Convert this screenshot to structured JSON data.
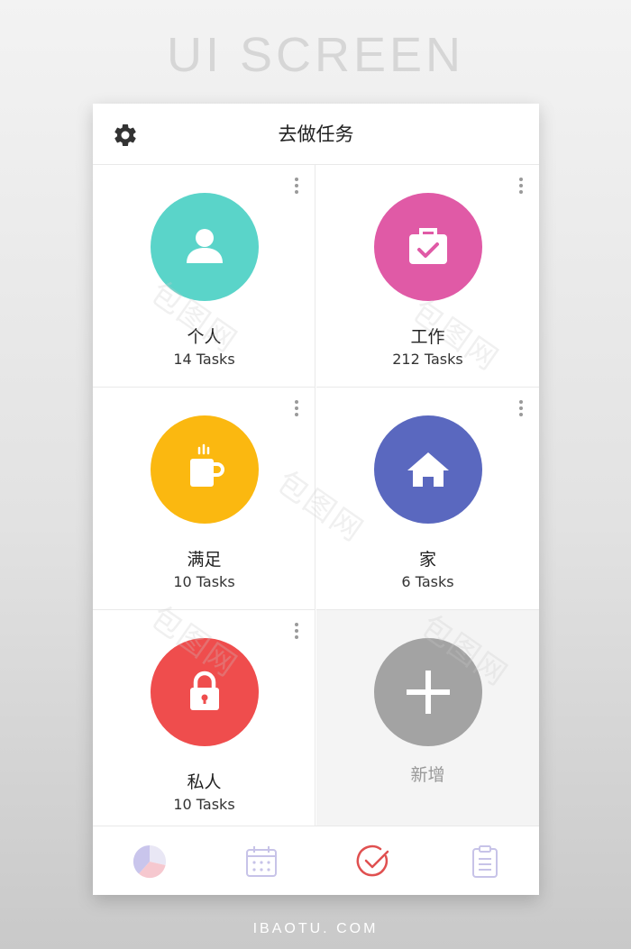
{
  "banner": "UI SCREEN",
  "footer_watermark": "IBAOTU. COM",
  "watermark_text": "包图网",
  "header": {
    "title": "去做任务",
    "settings_icon": "gear-icon"
  },
  "categories": [
    {
      "name": "个人",
      "count": "14 Tasks",
      "color": "#5ad4c9",
      "icon": "person-icon"
    },
    {
      "name": "工作",
      "count": "212 Tasks",
      "color": "#e05aa6",
      "icon": "briefcase-check-icon"
    },
    {
      "name": "满足",
      "count": "10 Tasks",
      "color": "#fbb810",
      "icon": "coffee-mug-icon"
    },
    {
      "name": "家",
      "count": "6 Tasks",
      "color": "#5a68bf",
      "icon": "house-icon"
    },
    {
      "name": "私人",
      "count": "10 Tasks",
      "color": "#ef4d4d",
      "icon": "lock-icon"
    }
  ],
  "add_new": {
    "label": "新增",
    "color": "#a3a3a3",
    "icon": "plus-icon"
  },
  "tabbar": [
    {
      "name": "stats",
      "icon": "pie-chart-icon",
      "active": false
    },
    {
      "name": "calendar",
      "icon": "calendar-icon",
      "active": false
    },
    {
      "name": "tasks",
      "icon": "check-circle-icon",
      "active": true
    },
    {
      "name": "notes",
      "icon": "clipboard-icon",
      "active": false
    }
  ],
  "colors": {
    "active_tab": "#e05050",
    "inactive_tab": "#c7c3e8"
  }
}
